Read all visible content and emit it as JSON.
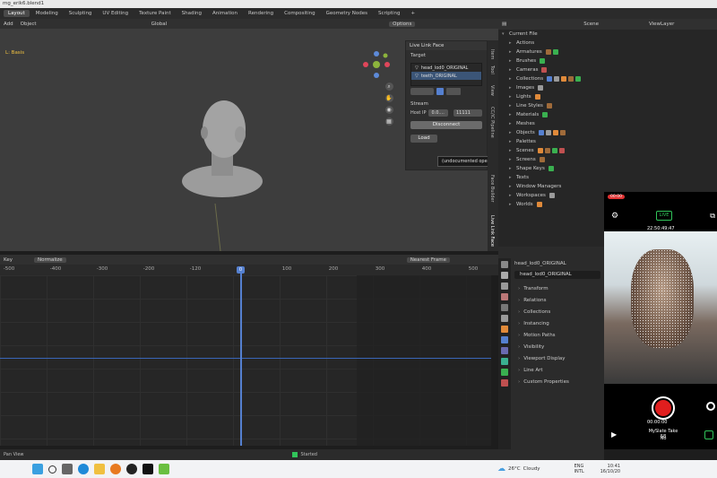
{
  "window_title": "mg_erik6.blend1",
  "workspaces": [
    "Layout",
    "Modeling",
    "Sculpting",
    "UV Editing",
    "Texture Paint",
    "Shading",
    "Animation",
    "Rendering",
    "Compositing",
    "Geometry Nodes",
    "Scripting",
    "+"
  ],
  "header": {
    "mode": "Add",
    "object": "Object",
    "orientation": "Global",
    "options": "Options"
  },
  "viewport": {
    "object_label": "L: Basis"
  },
  "npanel": {
    "title": "Live Link Face",
    "target_label": "Target",
    "targets": [
      "head_lod0_ORIGINAL",
      "teeth_ORIGINAL"
    ],
    "stream_label": "Stream",
    "host_label": "Host IP",
    "host_value": "0.0....",
    "port_value": "11111",
    "disconnect_label": "Disconnect",
    "load_label": "Load",
    "tooltip": "(undocumented operator)",
    "tabs": [
      "Item",
      "Tool",
      "View",
      "CC/iC Pipeline",
      "Face Builder",
      "Live Link Face"
    ]
  },
  "timeline": {
    "key_label": "Key",
    "mode": "Normalize",
    "nearest": "Nearest Frame",
    "ticks": [
      "-500",
      "-400",
      "-300",
      "-200",
      "-120",
      "0",
      "100",
      "200",
      "300",
      "400",
      "500"
    ],
    "current_frame": "0"
  },
  "status": {
    "left": "Pan View",
    "middle": "Started"
  },
  "outliner": {
    "scene_label": "Scene",
    "view_layer": "ViewLayer",
    "root": "Current File",
    "items": [
      "Actions",
      "Armatures",
      "Brushes",
      "Cameras",
      "Collections",
      "Images",
      "Lights",
      "Line Styles",
      "Materials",
      "Meshes",
      "Objects",
      "Palettes",
      "Scenes",
      "Screens",
      "Shape Keys",
      "Texts",
      "Window Managers",
      "Workspaces",
      "Worlds"
    ]
  },
  "properties": {
    "object_name": "head_lod0_ORIGINAL",
    "object_name_field": "head_lod0_ORIGINAL",
    "sections": [
      "Transform",
      "Relations",
      "Collections",
      "Instancing",
      "Motion Paths",
      "Visibility",
      "Viewport Display",
      "Line Art",
      "Custom Properties"
    ]
  },
  "phone": {
    "rec_badge": "00:00",
    "live_label": "LIVE",
    "timecode": "22:50:49:47",
    "rec_time": "00:00:00",
    "take_label": "MySlate Take 58",
    "take_sub": "No"
  },
  "taskbar": {
    "weather_temp": "26°C",
    "weather_desc": "Cloudy",
    "lang": "ENG",
    "lang_sub": "INTL",
    "time": "10:41",
    "date": "16/10/20"
  },
  "colors": {
    "accent": "#5580d0",
    "selection": "#3b5577",
    "record": "#e01e1e",
    "live": "#31c45a"
  }
}
